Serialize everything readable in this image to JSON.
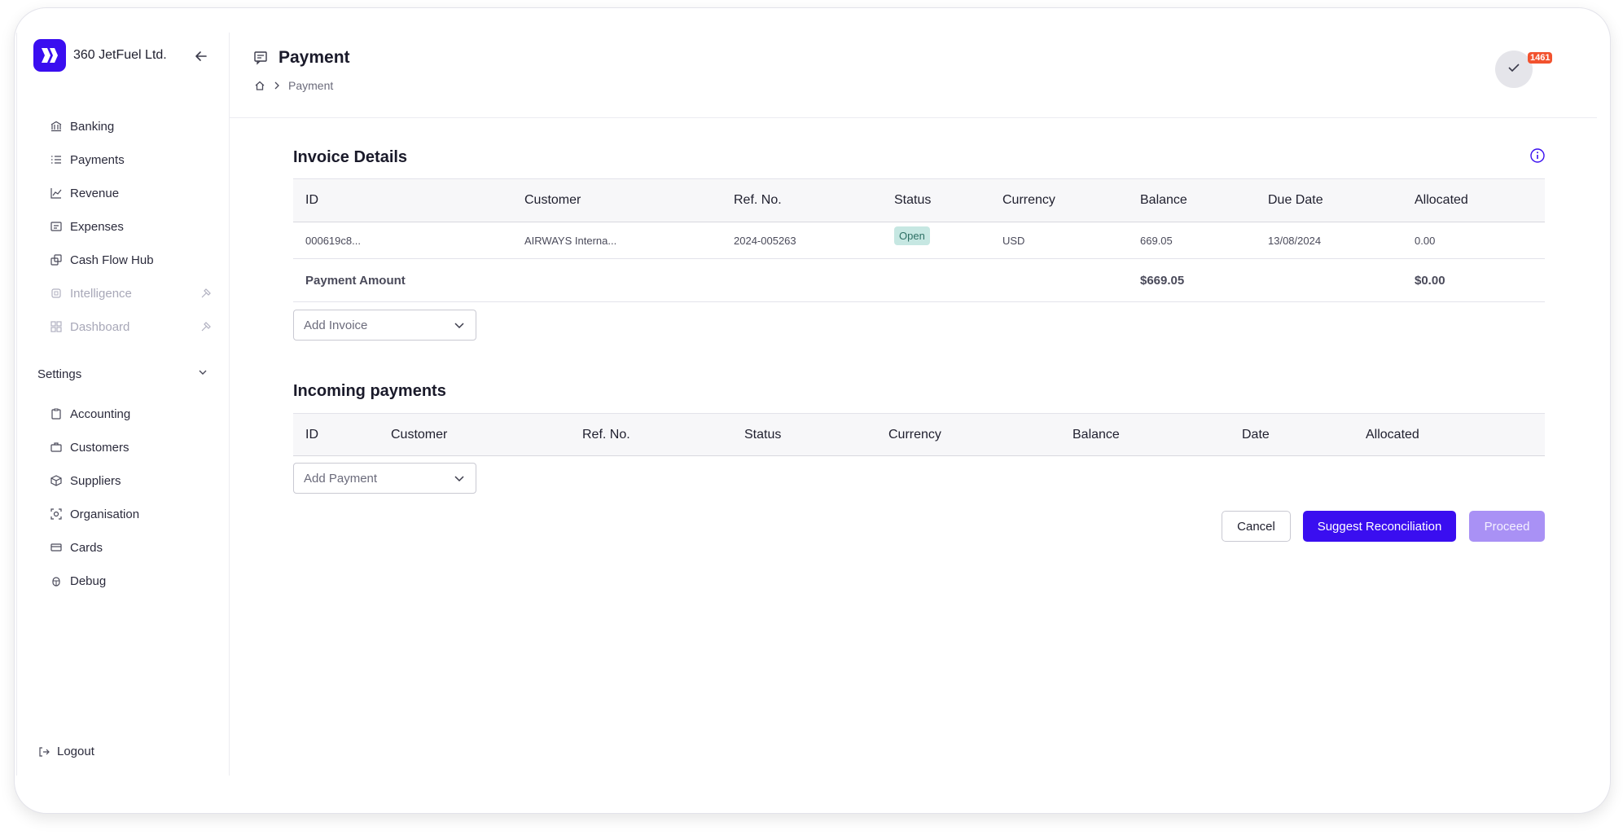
{
  "app": {
    "company": "360 JetFuel Ltd."
  },
  "sidebar": {
    "items": [
      {
        "label": "Banking",
        "icon": "bank-icon",
        "disabled": false
      },
      {
        "label": "Payments",
        "icon": "list-icon",
        "disabled": false
      },
      {
        "label": "Revenue",
        "icon": "chart-line-icon",
        "disabled": false
      },
      {
        "label": "Expenses",
        "icon": "receipt-icon",
        "disabled": false
      },
      {
        "label": "Cash Flow Hub",
        "icon": "stack-icon",
        "disabled": false
      },
      {
        "label": "Intelligence",
        "icon": "brain-icon",
        "disabled": true
      },
      {
        "label": "Dashboard",
        "icon": "grid-icon",
        "disabled": true
      }
    ],
    "settings_label": "Settings",
    "settings_items": [
      {
        "label": "Accounting",
        "icon": "clipboard-icon"
      },
      {
        "label": "Customers",
        "icon": "briefcase-icon"
      },
      {
        "label": "Suppliers",
        "icon": "box-icon"
      },
      {
        "label": "Organisation",
        "icon": "organisation-icon"
      },
      {
        "label": "Cards",
        "icon": "card-icon"
      },
      {
        "label": "Debug",
        "icon": "bug-icon"
      }
    ],
    "logout_label": "Logout"
  },
  "header": {
    "title": "Payment",
    "breadcrumb": "Payment",
    "notification_count": "1461"
  },
  "invoice": {
    "title": "Invoice Details",
    "columns": [
      "ID",
      "Customer",
      "Ref. No.",
      "Status",
      "Currency",
      "Balance",
      "Due Date",
      "Allocated"
    ],
    "rows": [
      {
        "id": "000619c8...",
        "customer": "AIRWAYS Interna...",
        "ref": "2024-005263",
        "status": "Open",
        "currency": "USD",
        "balance": "669.05",
        "due_date": "13/08/2024",
        "allocated": "0.00"
      }
    ],
    "total_label": "Payment Amount",
    "total_balance": "$669.05",
    "total_allocated": "$0.00",
    "add_placeholder": "Add Invoice"
  },
  "incoming": {
    "title": "Incoming payments",
    "columns": [
      "ID",
      "Customer",
      "Ref. No.",
      "Status",
      "Currency",
      "Balance",
      "Date",
      "Allocated"
    ],
    "add_placeholder": "Add Payment"
  },
  "actions": {
    "cancel": "Cancel",
    "suggest": "Suggest Reconciliation",
    "proceed": "Proceed"
  },
  "colors": {
    "accent": "#3a0ef0",
    "proceed_disabled": "#a991f5",
    "badge_open_bg": "#c6e7e2",
    "notification_badge": "#f2522e"
  }
}
